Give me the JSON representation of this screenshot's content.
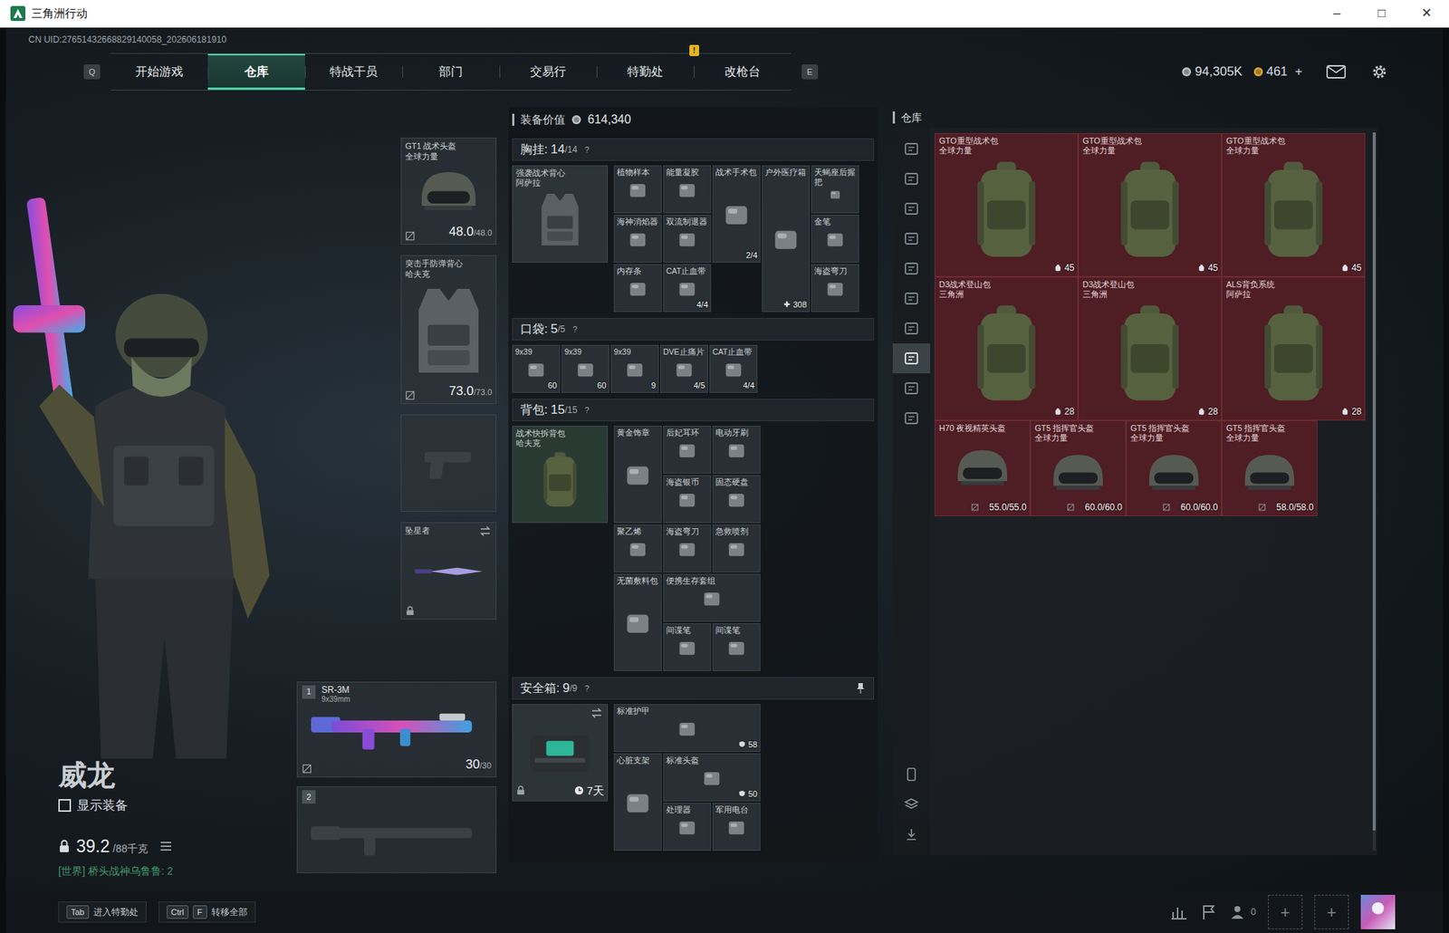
{
  "window": {
    "title": "三角洲行动",
    "controls": [
      "–",
      "□",
      "✕"
    ]
  },
  "uid": "CN UID:27651432668829140058_202606181910",
  "nav": {
    "prev_key": "Q",
    "next_key": "E",
    "tabs": [
      {
        "label": "开始游戏",
        "selected": false
      },
      {
        "label": "仓库",
        "selected": true
      },
      {
        "label": "特战干员",
        "selected": false
      },
      {
        "label": "部门",
        "selected": false
      },
      {
        "label": "交易行",
        "selected": false
      },
      {
        "label": "特勤处",
        "selected": false,
        "alert": "!"
      },
      {
        "label": "改枪台",
        "selected": false
      }
    ],
    "coins": "94,305K",
    "tickets": "461",
    "add": "+"
  },
  "operator": {
    "name": "威龙",
    "show_gear": {
      "label": "显示装备",
      "checked": false
    },
    "weight": "39.2",
    "weight_max": "/88千克",
    "chat": "[世界] 桥头战神乌鲁鲁: 2"
  },
  "slots": [
    {
      "kind": "helmet",
      "name": "GT1 战术头盔",
      "brand": "全球力量",
      "value": "48.0",
      "max": "/48.0"
    },
    {
      "kind": "vest",
      "name": "突击手防弹背心",
      "brand": "哈夫克",
      "value": "73.0",
      "max": "/73.0"
    },
    {
      "kind": "empty"
    },
    {
      "kind": "melee",
      "name": "坠星者",
      "locked": true
    }
  ],
  "weapons": [
    {
      "kind": "gun",
      "index": "1",
      "name": "SR-3M",
      "caliber": "9x39mm",
      "ammo": "30",
      "ammo_max": "/30"
    },
    {
      "kind": "empty",
      "index": "2"
    }
  ],
  "loadout": {
    "value_label": "装备价值",
    "value": "614,340",
    "sections": [
      {
        "title": "胸挂:",
        "count": "14",
        "max": "/14",
        "help": "?",
        "container": {
          "name": "强袭战术背心",
          "brand": "阿萨拉"
        },
        "items": [
          {
            "name": "植物样本"
          },
          {
            "name": "能量凝胶"
          },
          {
            "name": "战术手术包",
            "count": "2/4"
          },
          {
            "name": "户外医疗箱",
            "count": "308"
          },
          {
            "name": "天蝎座后握把"
          },
          {
            "name": "海神消焰器"
          },
          {
            "name": "双流制退器"
          },
          {
            "name": "金笔"
          },
          {
            "name": "内存条"
          },
          {
            "name": "CAT止血带",
            "count": "4/4"
          },
          {
            "name": "海盗弯刀"
          }
        ]
      },
      {
        "title": "口袋:",
        "count": "5",
        "max": "/5",
        "help": "?",
        "items": [
          {
            "name": "9x39",
            "count": "60"
          },
          {
            "name": "9x39",
            "count": "60"
          },
          {
            "name": "9x39",
            "count": "9"
          },
          {
            "name": "DVE止痛片",
            "count": "4/5"
          },
          {
            "name": "CAT止血带",
            "count": "4/4"
          }
        ]
      },
      {
        "title": "背包:",
        "count": "15",
        "max": "/15",
        "help": "?",
        "container": {
          "name": "战术快拆背包",
          "brand": "哈夫克"
        },
        "items": [
          {
            "name": "黄金饰章"
          },
          {
            "name": "后妃耳环"
          },
          {
            "name": "电动牙刷"
          },
          {
            "name": "海盗银币"
          },
          {
            "name": "固态硬盘"
          },
          {
            "name": "聚乙烯"
          },
          {
            "name": "海盗弯刀"
          },
          {
            "name": "急救喷剂"
          },
          {
            "name": "无菌敷料包"
          },
          {
            "name": "便携生存套组"
          },
          {
            "name": "间谍笔"
          },
          {
            "name": "间谍笔"
          }
        ]
      },
      {
        "title": "安全箱:",
        "count": "9",
        "max": "/9",
        "help": "?",
        "pinned": true,
        "container": {
          "timer": "7天",
          "locked": true
        },
        "items": [
          {
            "name": "标准护甲",
            "count": "58"
          },
          {
            "name": "心脏支架"
          },
          {
            "name": "标准头盔",
            "count": "50"
          },
          {
            "name": "处理器"
          },
          {
            "name": "军用电台"
          }
        ]
      }
    ]
  },
  "warehouse": {
    "title": "仓库",
    "tabs": [
      {
        "selected": false
      },
      {
        "selected": false
      },
      {
        "selected": false
      },
      {
        "selected": false
      },
      {
        "selected": false
      },
      {
        "selected": false
      },
      {
        "selected": false
      },
      {
        "selected": true
      },
      {
        "selected": false
      },
      {
        "selected": false
      }
    ],
    "items": [
      {
        "kind": "backpack",
        "name": "GTO重型战术包",
        "brand": "全球力量",
        "count": "45"
      },
      {
        "kind": "backpack",
        "name": "GTO重型战术包",
        "brand": "全球力量",
        "count": "45"
      },
      {
        "kind": "backpack",
        "name": "GTO重型战术包",
        "brand": "全球力量",
        "count": "45"
      },
      {
        "kind": "backpack",
        "name": "D3战术登山包",
        "brand": "三角洲",
        "count": "28"
      },
      {
        "kind": "backpack",
        "name": "D3战术登山包",
        "brand": "三角洲",
        "count": "28"
      },
      {
        "kind": "backpack",
        "name": "ALS背负系统",
        "brand": "阿萨拉",
        "count": "28"
      },
      {
        "kind": "helmet",
        "name": "H70 夜视精英头盔",
        "count": "55.0/55.0"
      },
      {
        "kind": "helmet",
        "name": "GT5 指挥官头盔",
        "brand": "全球力量",
        "count": "60.0/60.0"
      },
      {
        "kind": "helmet",
        "name": "GT5 指挥官头盔",
        "brand": "全球力量",
        "count": "60.0/60.0"
      },
      {
        "kind": "helmet",
        "name": "GT5 指挥官头盔",
        "brand": "全球力量",
        "count": "58.0/58.0"
      }
    ]
  },
  "bottom": {
    "hints": [
      {
        "keys": [
          "Tab"
        ],
        "label": "进入特勤处"
      },
      {
        "keys": [
          "Ctrl",
          "F"
        ],
        "label": "转移全部"
      }
    ],
    "friends": "0",
    "add_slots": [
      "+",
      "+"
    ]
  }
}
